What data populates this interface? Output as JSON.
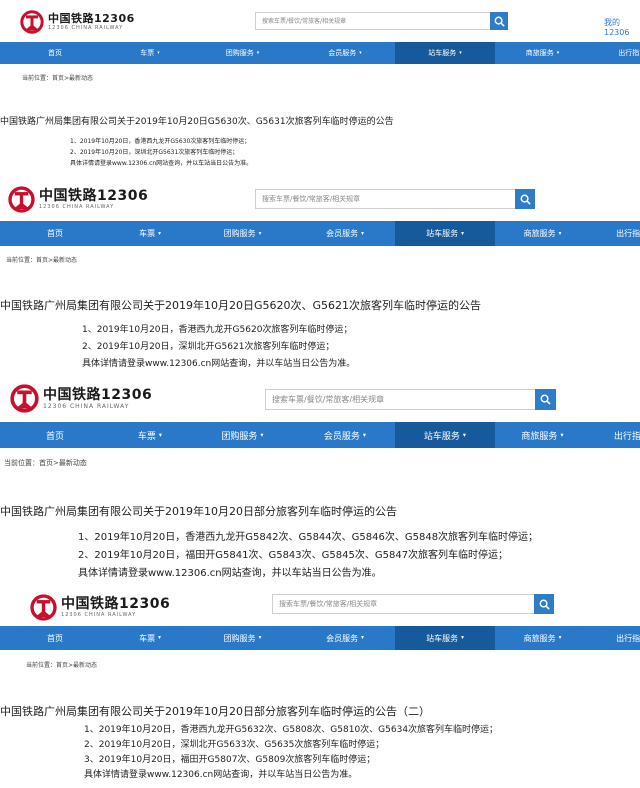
{
  "site": {
    "logo_cn": "中国铁路12306",
    "logo_en": "12306 CHINA RAILWAY",
    "search_placeholder": "搜索车票/餐饮/常旅客/相关规章",
    "my_account": "我的12306",
    "breadcrumb": "当前位置：首页>最新动态"
  },
  "nav": [
    "首页",
    "车票",
    "团购服务",
    "会员服务",
    "站车服务",
    "商旅服务",
    "出行指南"
  ],
  "active_nav": "站车服务",
  "colors": {
    "nav_bg": "#2a79c8",
    "nav_active": "#175a9c",
    "search_btn": "#2f7cc8",
    "logo_red": "#c8102e"
  },
  "notices": [
    {
      "title": "中国铁路广州局集团有限公司关于2019年10月20日G5630次、G5631次旅客列车临时停运的公告",
      "lines": [
        "1、2019年10月20日，香港西九龙开G5630次旅客列车临时停运；",
        "2、2019年10月20日，深圳北开G5631次旅客列车临时停运；",
        "具体详情请登录www.12306.cn网站查询，并以车站当日公告为准。"
      ]
    },
    {
      "title": "中国铁路广州局集团有限公司关于2019年10月20日G5620次、G5621次旅客列车临时停运的公告",
      "lines": [
        "1、2019年10月20日，香港西九龙开G5620次旅客列车临时停运；",
        "2、2019年10月20日，深圳北开G5621次旅客列车临时停运；",
        "具体详情请登录www.12306.cn网站查询，并以车站当日公告为准。"
      ]
    },
    {
      "title": "中国铁路广州局集团有限公司关于2019年10月20日部分旅客列车临时停运的公告",
      "lines": [
        "1、2019年10月20日，香港西九龙开G5842次、G5844次、G5846次、G5848次旅客列车临时停运；",
        "2、2019年10月20日，福田开G5841次、G5843次、G5845次、G5847次旅客列车临时停运；",
        "具体详情请登录www.12306.cn网站查询，并以车站当日公告为准。"
      ]
    },
    {
      "title": "中国铁路广州局集团有限公司关于2019年10月20日部分旅客列车临时停运的公告（二）",
      "lines": [
        "1、2019年10月20日，香港西九龙开G5632次、G5808次、G5810次、G5634次旅客列车临时停运；",
        "2、2019年10月20日，深圳北开G5633次、G5635次旅客列车临时停运；",
        "3、2019年10月20日，福田开G5807次、G5809次旅客列车临时停运；",
        "具体详情请登录www.12306.cn网站查询，并以车站当日公告为准。"
      ]
    }
  ]
}
